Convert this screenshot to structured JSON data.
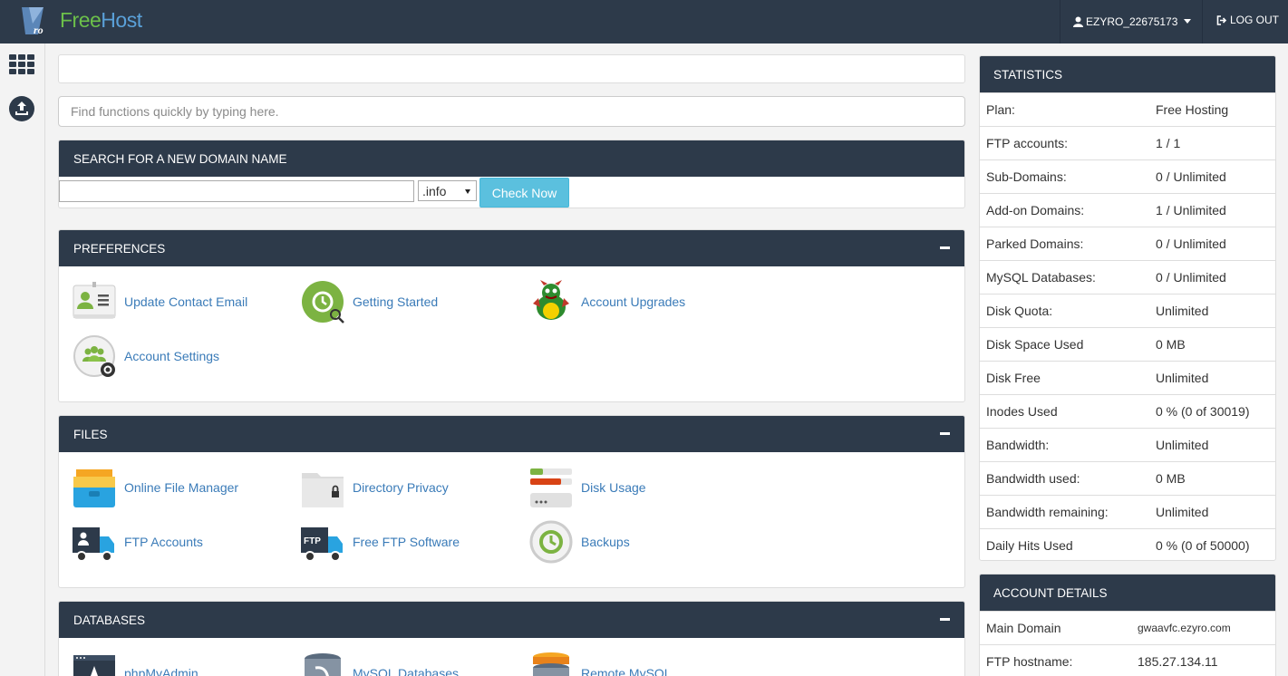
{
  "brand": {
    "free": "Free",
    "host": "Host",
    "logo_text": "ro"
  },
  "header": {
    "username": "EZYRO_22675173",
    "logout": "LOG OUT"
  },
  "rail": {
    "grid_icon": "grid-icon",
    "upload_icon": "upload-icon"
  },
  "quick_search": {
    "placeholder": "Find functions quickly by typing here."
  },
  "domain_search": {
    "title": "SEARCH FOR A NEW DOMAIN NAME",
    "value": "",
    "tld": ".info",
    "button": "Check Now"
  },
  "preferences": {
    "title": "PREFERENCES",
    "items": [
      {
        "label": "Update Contact Email",
        "icon": "contact-card-icon"
      },
      {
        "label": "Getting Started",
        "icon": "getting-started-icon"
      },
      {
        "label": "Account Upgrades",
        "icon": "dragon-icon"
      },
      {
        "label": "Account Settings",
        "icon": "users-gear-icon"
      }
    ]
  },
  "files": {
    "title": "FILES",
    "items": [
      {
        "label": "Online File Manager",
        "icon": "file-manager-icon"
      },
      {
        "label": "Directory Privacy",
        "icon": "locked-folder-icon"
      },
      {
        "label": "Disk Usage",
        "icon": "disk-usage-icon"
      },
      {
        "label": "FTP Accounts",
        "icon": "ftp-truck-icon"
      },
      {
        "label": "Free FTP Software",
        "icon": "ftp-software-icon"
      },
      {
        "label": "Backups",
        "icon": "backup-icon"
      }
    ]
  },
  "databases": {
    "title": "DATABASES",
    "items": [
      {
        "label": "phpMyAdmin",
        "icon": "phpmyadmin-icon"
      },
      {
        "label": "MySQL Databases",
        "icon": "mysql-icon"
      },
      {
        "label": "Remote MySQL",
        "icon": "remote-mysql-icon"
      }
    ]
  },
  "statistics": {
    "title": "STATISTICS",
    "rows": [
      {
        "key": "Plan:",
        "value": "Free Hosting"
      },
      {
        "key": "FTP accounts:",
        "value": "1 / 1"
      },
      {
        "key": "Sub-Domains:",
        "value": "0 / Unlimited"
      },
      {
        "key": "Add-on Domains:",
        "value": "1 / Unlimited"
      },
      {
        "key": "Parked Domains:",
        "value": "0 / Unlimited"
      },
      {
        "key": "MySQL Databases:",
        "value": "0 / Unlimited"
      },
      {
        "key": "Disk Quota:",
        "value": "Unlimited"
      },
      {
        "key": "Disk Space Used",
        "value": "0 MB"
      },
      {
        "key": "Disk Free",
        "value": "Unlimited"
      },
      {
        "key": "Inodes Used",
        "value": "0 % (0 of 30019)"
      },
      {
        "key": "Bandwidth:",
        "value": "Unlimited"
      },
      {
        "key": "Bandwidth used:",
        "value": "0 MB"
      },
      {
        "key": "Bandwidth remaining:",
        "value": "Unlimited"
      },
      {
        "key": "Daily Hits Used",
        "value": "0 % (0 of 50000)"
      }
    ]
  },
  "account_details": {
    "title": "ACCOUNT DETAILS",
    "rows": [
      {
        "key": "Main Domain",
        "value": "gwaavfc.ezyro.com"
      },
      {
        "key": "FTP hostname:",
        "value": "185.27.134.11"
      }
    ]
  },
  "colors": {
    "topbar": "#2d3a4a",
    "link": "#3a7bb8",
    "button": "#5bc0de",
    "brand_green": "#6cc04a",
    "brand_blue": "#5aa0d8"
  }
}
